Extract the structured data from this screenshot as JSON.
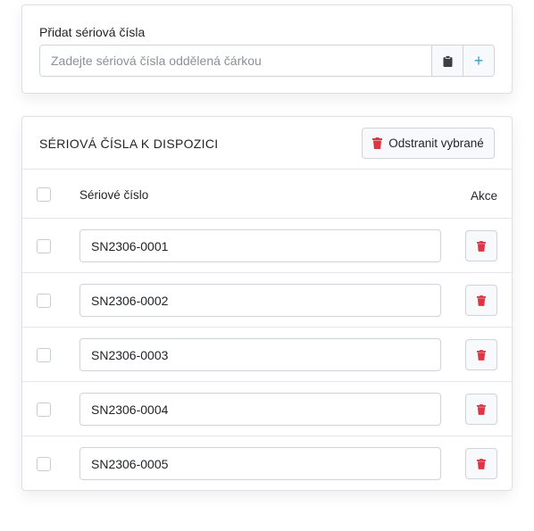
{
  "add_panel": {
    "label": "Přidat sériová čísla",
    "placeholder": "Zadejte sériová čísla oddělená čárkou",
    "paste_icon": "clipboard-icon",
    "add_icon": "plus-icon",
    "add_label": "+"
  },
  "list_panel": {
    "title": "SÉRIOVÁ ČÍSLA K DISPOZICI",
    "remove_selected_label": "Odstranit vybrané",
    "columns": {
      "serial": "Sériové číslo",
      "actions": "Akce"
    },
    "rows": [
      {
        "serial": "SN2306-0001"
      },
      {
        "serial": "SN2306-0002"
      },
      {
        "serial": "SN2306-0003"
      },
      {
        "serial": "SN2306-0004"
      },
      {
        "serial": "SN2306-0005"
      }
    ]
  },
  "colors": {
    "accent": "#2aa1d9",
    "danger": "#dc3545",
    "border": "#ced4da"
  }
}
